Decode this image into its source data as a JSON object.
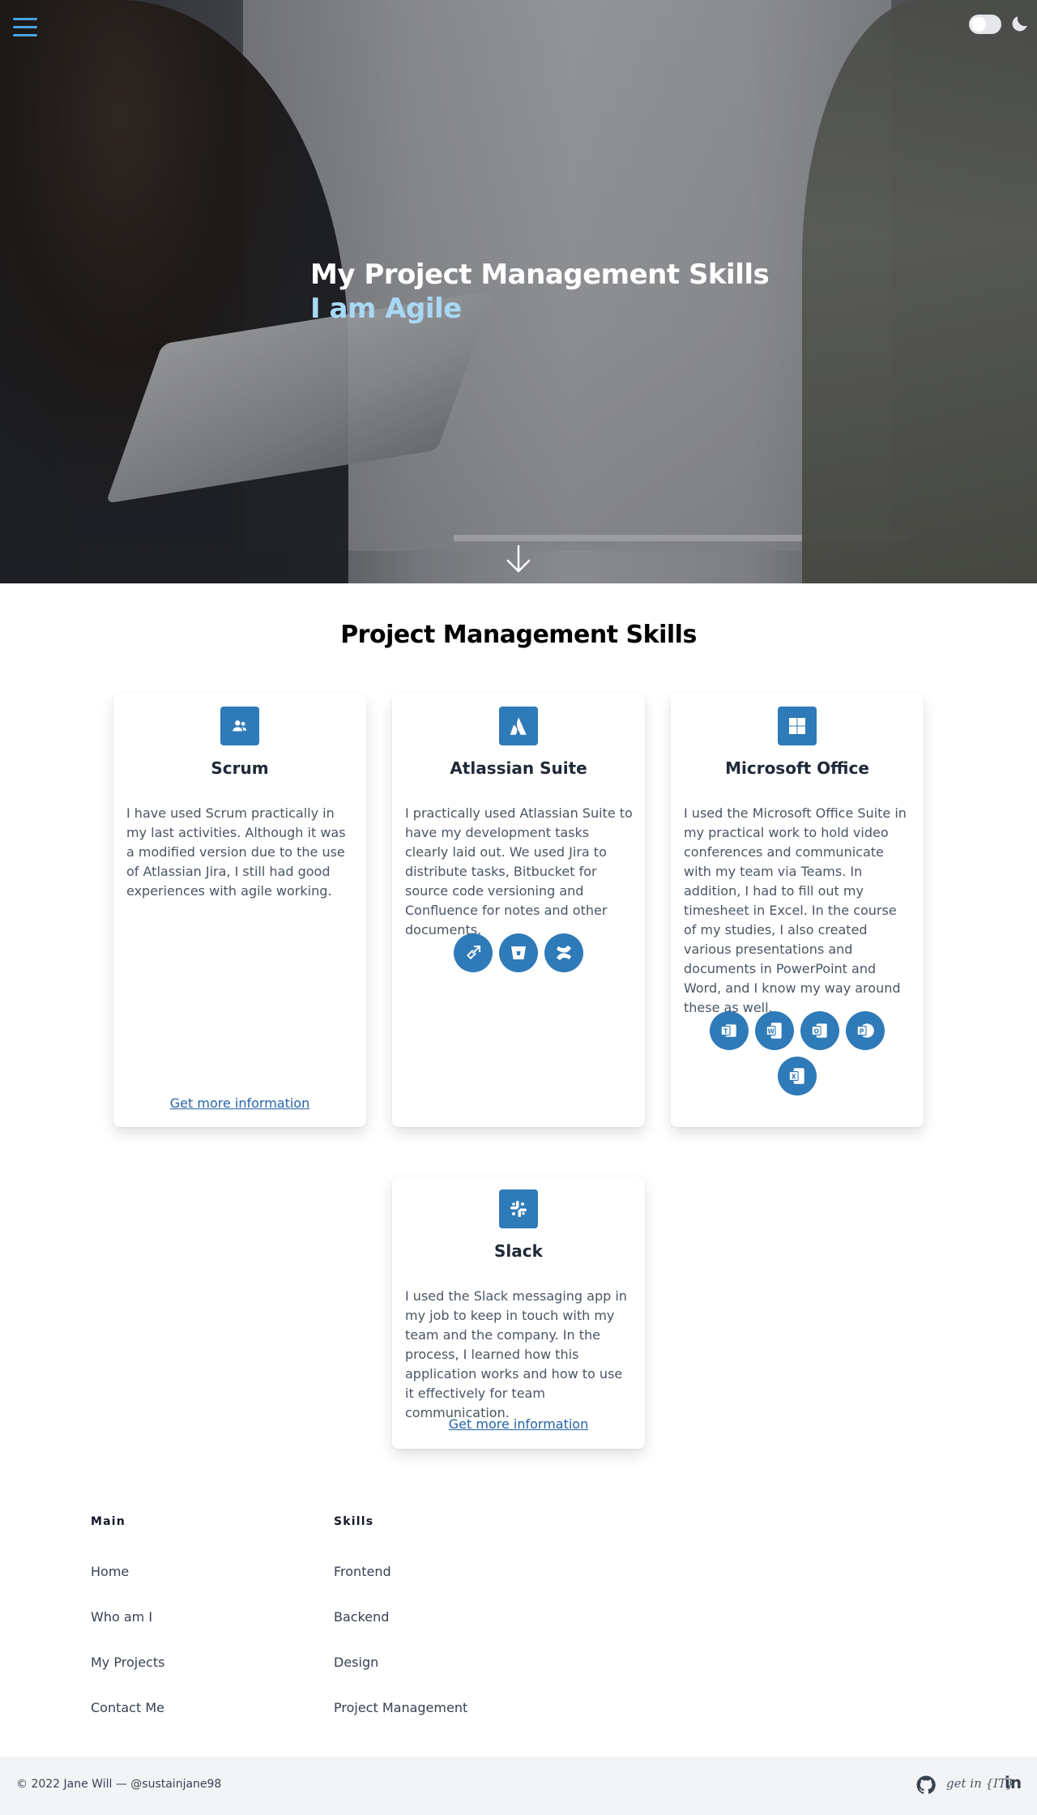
{
  "hero": {
    "title": "My Project Management Skills",
    "subtitle": "I am Agile"
  },
  "section": {
    "title": "Project Management Skills"
  },
  "cards": [
    {
      "title": "Scrum",
      "icon": "users-icon",
      "text": "I have used Scrum practically in my last activities. Although it was a modified version due to the use of Atlassian Jira, I still had good experiences with agile working.",
      "link": "Get more information"
    },
    {
      "title": "Atlassian Suite",
      "icon": "atlassian-icon",
      "text": "I practically used Atlassian Suite to have my development tasks clearly laid out. We used Jira to distribute tasks, Bitbucket for source code versioning and Confluence for notes and other documents.",
      "tools": [
        "jira-icon",
        "bitbucket-icon",
        "confluence-icon"
      ]
    },
    {
      "title": "Microsoft Office",
      "icon": "windows-icon",
      "text": "I used the Microsoft Office Suite in my practical work to hold video conferences and communicate with my team via Teams. In addition, I had to fill out my timesheet in Excel. In the course of my studies, I also created various presentations and documents in PowerPoint and Word, and I know my way around these as well.",
      "tools": [
        "teams-icon",
        "word-icon",
        "outlook-icon",
        "powerpoint-icon",
        "excel-icon"
      ]
    },
    {
      "title": "Slack",
      "icon": "slack-icon",
      "text": "I used the Slack messaging app in my job to keep in touch with my team and the company. In the process, I learned how this application works and how to use it effectively for team communication.",
      "link": "Get more information"
    }
  ],
  "footer": {
    "main_heading": "Main",
    "main_links": [
      "Home",
      "Who am I",
      "My Projects",
      "Contact Me"
    ],
    "skills_heading": "Skills",
    "skills_links": [
      "Frontend",
      "Backend",
      "Design",
      "Project Management"
    ],
    "copyright": "© 2022 Jane Will — @sustainjane98",
    "getin": "get in {IT}",
    "linkedin": "in"
  },
  "colors": {
    "accent": "#2f7ab8",
    "hero_sub": "#a9d8f5",
    "link": "#2563a8",
    "menu": "#4aa3df"
  }
}
